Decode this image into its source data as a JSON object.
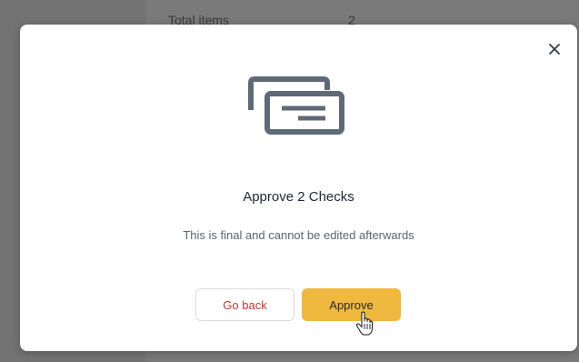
{
  "background": {
    "summary_label": "Total items",
    "summary_value": "2"
  },
  "modal": {
    "close_icon": "close-icon",
    "illustration_icon": "checks-icon",
    "title": "Approve 2 Checks",
    "description": "This is final and cannot be edited afterwards",
    "buttons": {
      "back_label": "Go back",
      "approve_label": "Approve"
    }
  },
  "colors": {
    "overlay": "#737373",
    "approve_button": "#efb83e",
    "back_button_text": "#c23a2b",
    "icon": "#5f6a78"
  },
  "cursor": "pointer-hand"
}
